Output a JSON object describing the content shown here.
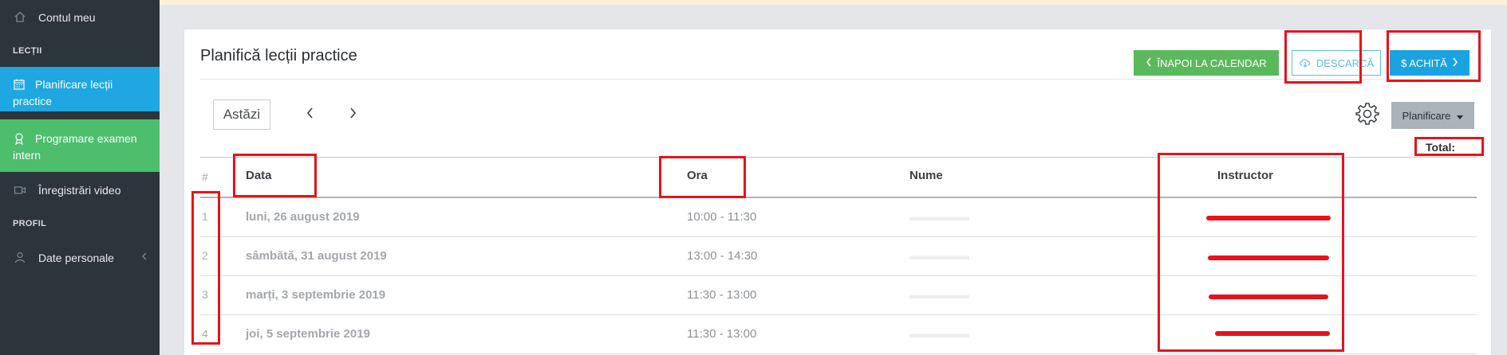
{
  "sidebar": {
    "account_label": "Contul meu",
    "section_lessons": "LECȚII",
    "plan_lessons_label": "Planificare lecții practice",
    "exam_label": "Programare examen intern",
    "video_label": "Înregistrări video",
    "section_profile": "PROFIL",
    "personal_label": "Date personale"
  },
  "header": {
    "title": "Planifică lecții practice",
    "back_label": "ÎNAPOI LA CALENDAR",
    "download_label": "DESCARCĂ",
    "pay_label": "$ ACHITĂ"
  },
  "toolbar": {
    "today_label": "Astăzi",
    "planning_label": "Planificare",
    "total_label": "Total:"
  },
  "table": {
    "columns": [
      "#",
      "Data",
      "Ora",
      "Nume",
      "Instructor"
    ],
    "rows": [
      {
        "index": "1",
        "date": "luni, 26 august 2019",
        "time": "10:00 - 11:30"
      },
      {
        "index": "2",
        "date": "sâmbătă, 31 august 2019",
        "time": "13:00 - 14:30"
      },
      {
        "index": "3",
        "date": "marți, 3 septembrie 2019",
        "time": "11:30 - 13:00"
      },
      {
        "index": "4",
        "date": "joi, 5 septembrie 2019",
        "time": "11:30 - 13:00"
      }
    ]
  },
  "colors": {
    "sidebar_bg": "#2c343c",
    "active_item": "#1ea7e0",
    "exam_item": "#4cbe6c",
    "back_button": "#5cb85c",
    "pay_button": "#1aa3e0",
    "annotation": "#e8121b"
  },
  "icons": [
    "home-icon",
    "calendar-icon",
    "award-icon",
    "video-icon",
    "user-icon",
    "chevron-left-icon",
    "chevron-right-icon",
    "cloud-download-icon",
    "gear-icon",
    "caret-down-icon"
  ]
}
